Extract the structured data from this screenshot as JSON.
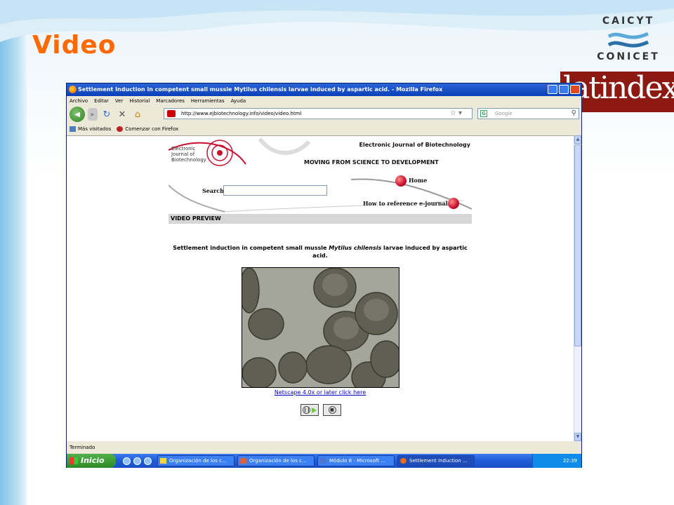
{
  "slide": {
    "title": "Video",
    "logos": {
      "caicyt_top": "CAICYT",
      "caicyt_bottom": "CONICET",
      "latindex": "latindex"
    }
  },
  "browser": {
    "window_title": "Settlement Induction in competent small mussle Mytilus chilensis larvae induced by aspartic acid. - Mozilla Firefox",
    "menu": [
      "Archivo",
      "Editar",
      "Ver",
      "Historial",
      "Marcadores",
      "Herramientas",
      "Ayuda"
    ],
    "url": "http://www.ejbiotechnology.info/video/video.html",
    "search_placeholder": "Google",
    "bookmarks": [
      "Más visitados",
      "Comenzar con Firefox"
    ],
    "status": "Terminado"
  },
  "page": {
    "logo_text": "Electronic Journal of Biotechnology",
    "journal_name": "Electronic Journal of Biotechnology",
    "motto": "MOVING FROM SCIENCE TO DEVELOPMENT",
    "search_label": "Search",
    "home_link": "Home",
    "howto_link": "How to reference e-journals",
    "section_header": "VIDEO PREVIEW",
    "video_title_prefix": "Settlement induction in competent small mussle ",
    "video_title_species": "Mytilus chilensis",
    "video_title_suffix": " larvae induced by aspartic acid.",
    "netscape_link": "Netscape 4.0x or later click here"
  },
  "taskbar": {
    "start_label": "Inicio",
    "items": [
      "Organización de los c...",
      "Organización de los c...",
      "Módulo 8 - Microsoft ...",
      "Settlement Induction ..."
    ],
    "clock": "22:39"
  }
}
